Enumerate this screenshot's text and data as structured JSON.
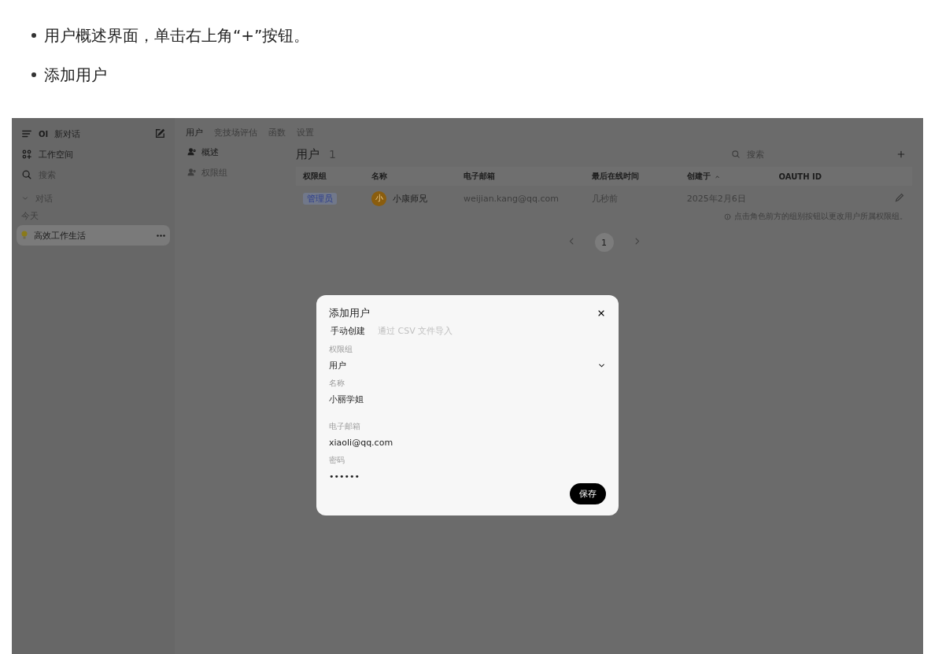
{
  "bullets": [
    "用户概述界面，单击右上角“+”按钮。",
    "添加用户"
  ],
  "screenshot": {
    "sidebar": {
      "logo": "OI",
      "new_chat": "新对话",
      "workspace": "工作空间",
      "search_placeholder": "搜索",
      "section": "对话",
      "group": "今天",
      "chats": [
        {
          "title": "高效工作生活",
          "selected": true
        }
      ]
    },
    "top_tabs": [
      {
        "label": "用户",
        "selected": true
      },
      {
        "label": "竞技场评估",
        "selected": false
      },
      {
        "label": "函数",
        "selected": false
      },
      {
        "label": "设置",
        "selected": false
      }
    ],
    "side_tabs": [
      {
        "label": "概述",
        "selected": true
      },
      {
        "label": "权限组",
        "selected": false
      }
    ],
    "title": "用户",
    "count": "1",
    "search_placeholder": "搜索",
    "table": {
      "columns": [
        "权限组",
        "名称",
        "电子邮箱",
        "最后在线时间",
        "创建于",
        "OAUTH ID"
      ],
      "rows": [
        {
          "role": "管理员",
          "avatar": "小",
          "name": "小康师兄",
          "email": "weijian.kang@qq.com",
          "last_active": "几秒前",
          "created": "2025年2月6日"
        }
      ]
    },
    "hint": "点击角色前方的组别按钮以更改用户所属权限组。",
    "pages": [
      {
        "label": "1",
        "selected": true
      }
    ],
    "dialog": {
      "title": "添加用户",
      "tabs": [
        {
          "label": "手动创建",
          "selected": true
        },
        {
          "label": "通过 CSV 文件导入",
          "selected": false
        }
      ],
      "fields": [
        {
          "kind": "select",
          "label": "权限组",
          "value": "用户"
        },
        {
          "kind": "text",
          "label": "名称",
          "value": "小丽学姐"
        },
        {
          "kind": "text",
          "label": "电子邮箱",
          "value": "xiaoli@qq.com"
        },
        {
          "kind": "password",
          "label": "密码",
          "value": "••••••"
        }
      ],
      "save": "保存"
    }
  }
}
